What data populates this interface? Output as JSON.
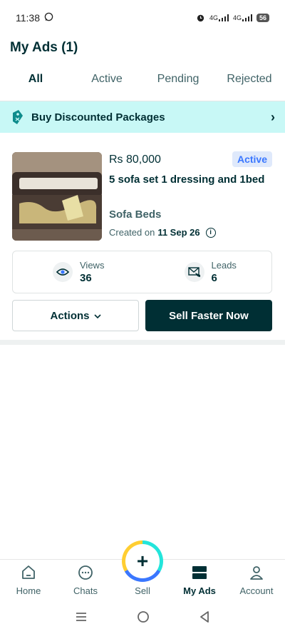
{
  "status_bar": {
    "time": "11:38",
    "network_1": "4G",
    "network_2": "4G",
    "battery": "56"
  },
  "page": {
    "title": "My Ads (1)"
  },
  "tabs": [
    {
      "label": "All",
      "active": true
    },
    {
      "label": "Active",
      "active": false
    },
    {
      "label": "Pending",
      "active": false
    },
    {
      "label": "Rejected",
      "active": false
    }
  ],
  "banner": {
    "label": "Buy Discounted Packages",
    "chevron": "›"
  },
  "ad": {
    "price": "Rs 80,000",
    "status": "Active",
    "title": "5 sofa set 1 dressing and 1bed",
    "category": "Sofa Beds",
    "created_prefix": "Created on",
    "created_date": "11 Sep 26",
    "views_label": "Views",
    "views_value": "36",
    "leads_label": "Leads",
    "leads_value": "6",
    "actions_label": "Actions",
    "sell_faster_label": "Sell Faster Now"
  },
  "bottom_nav": {
    "home": "Home",
    "chats": "Chats",
    "sell": "Sell",
    "my_ads": "My Ads",
    "account": "Account"
  },
  "colors": {
    "primary": "#002f34",
    "banner_bg": "#c8f8f6",
    "badge_bg": "#dfe9fb",
    "badge_text": "#3a77ff"
  }
}
